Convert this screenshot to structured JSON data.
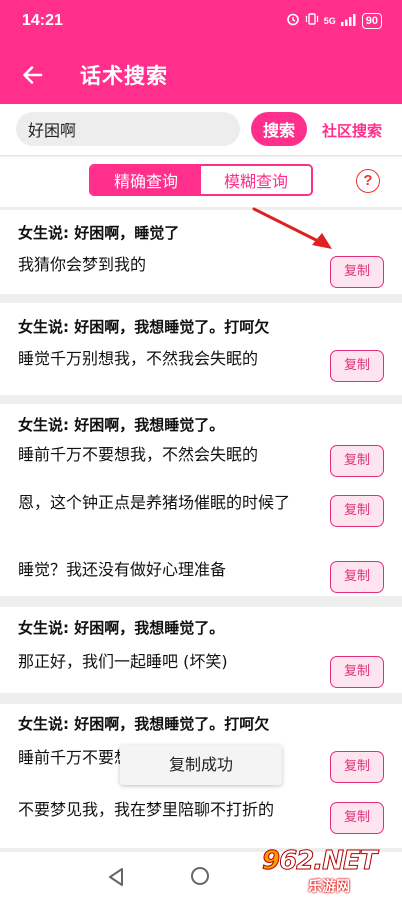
{
  "status_bar": {
    "time": "14:21",
    "network_label": "5G",
    "battery": "90"
  },
  "app_bar": {
    "title": "话术搜索",
    "back_icon": "arrow-left-icon"
  },
  "search": {
    "value": "好困啊",
    "button_label": "搜索",
    "community_link": "社区搜索"
  },
  "mode_toggle": {
    "options": [
      "精确查询",
      "模糊查询"
    ],
    "selected": "精确查询",
    "help_icon": "question-circle-icon",
    "help_glyph": "?"
  },
  "cards": [
    {
      "title": "女生说: 好困啊，睡觉了",
      "replies": [
        "我猜你会梦到我的"
      ]
    },
    {
      "title": "女生说: 好困啊，我想睡觉了。打呵欠",
      "replies": [
        "睡觉千万别想我，不然我会失眠的"
      ]
    },
    {
      "title": "女生说: 好困啊，我想睡觉了。",
      "replies": [
        "睡前千万不要想我，不然会失眠的",
        "恩，这个钟正点是养猪场催眠的时候了",
        "睡觉？我还没有做好心理准备"
      ]
    },
    {
      "title": "女生说: 好困啊，我想睡觉了。",
      "replies": [
        "那正好，我们一起睡吧 (坏笑)"
      ]
    },
    {
      "title": "女生说: 好困啊，我想睡觉了。打呵欠",
      "replies": [
        "睡前千万不要想我，不然会失眠的",
        "不要梦见我，我在梦里陪聊不打折的"
      ]
    }
  ],
  "copy_button_label": "复制",
  "toast": "复制成功",
  "watermark": {
    "logo_prefix": "9",
    "logo_rest": "62.NET",
    "sub": "乐游网"
  },
  "colors": {
    "accent": "#ff2f8b",
    "copy_border": "#e0307a",
    "copy_bg": "#fde4ee",
    "arrow": "#e02020"
  }
}
